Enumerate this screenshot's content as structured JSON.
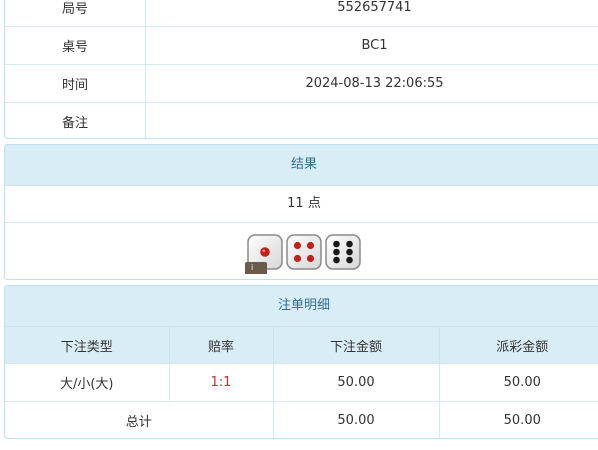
{
  "info": {
    "rows": [
      {
        "label": "局号",
        "value": "552657741"
      },
      {
        "label": "桌号",
        "value": "BC1"
      },
      {
        "label": "时间",
        "value": "2024-08-13 22:06:55"
      },
      {
        "label": "备注",
        "value": ""
      }
    ]
  },
  "result": {
    "title": "结果",
    "points": "11 点",
    "dice": [
      1,
      4,
      6
    ],
    "badge": "i"
  },
  "details": {
    "title": "注单明细",
    "headers": [
      "下注类型",
      "赔率",
      "下注金额",
      "派彩金额"
    ],
    "rows": [
      {
        "type": "大/小(大)",
        "odds": "1:1",
        "amount": "50.00",
        "payout": "50.00"
      }
    ],
    "total": {
      "label": "总计",
      "amount": "50.00",
      "payout": "50.00"
    }
  },
  "colors": {
    "header_bg": "#d9edf7",
    "header_text": "#31708f",
    "odds": "#c9302c"
  }
}
